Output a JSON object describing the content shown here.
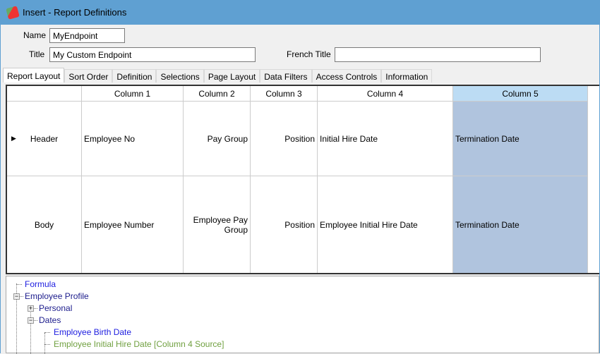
{
  "window": {
    "title": "Insert - Report Definitions"
  },
  "form": {
    "name_label": "Name",
    "name_value": "MyEndpoint",
    "title_label": "Title",
    "title_value": "My Custom Endpoint",
    "french_title_label": "French Title",
    "french_title_value": ""
  },
  "tabs": [
    "Report Layout",
    "Sort Order",
    "Definition",
    "Selections",
    "Page Layout",
    "Data Filters",
    "Access Controls",
    "Information"
  ],
  "active_tab": "Report Layout",
  "grid": {
    "columns": [
      "Column 1",
      "Column 2",
      "Column 3",
      "Column 4",
      "Column 5"
    ],
    "selected_column": "Column 5",
    "rows": [
      {
        "label": "Header",
        "cells": [
          "Employee No",
          "Pay Group",
          "Position",
          "Initial Hire Date",
          "Termination Date"
        ]
      },
      {
        "label": "Body",
        "cells": [
          "Employee Number",
          "Employee Pay Group",
          "Position",
          "Employee Initial Hire Date",
          "Termination Date"
        ]
      }
    ]
  },
  "tree": {
    "nodes": [
      {
        "label": "Formula",
        "color": "#2020e0"
      },
      {
        "label": "Employee Profile",
        "color": "#1c1c8c"
      },
      {
        "label": "Personal",
        "color": "#1c1c8c"
      },
      {
        "label": "Dates",
        "color": "#1c1c8c"
      },
      {
        "label": "Employee Birth Date",
        "color": "#2020e0"
      },
      {
        "label": "Employee Initial Hire Date [Column 4 Source]",
        "color": "#70a040"
      }
    ]
  }
}
